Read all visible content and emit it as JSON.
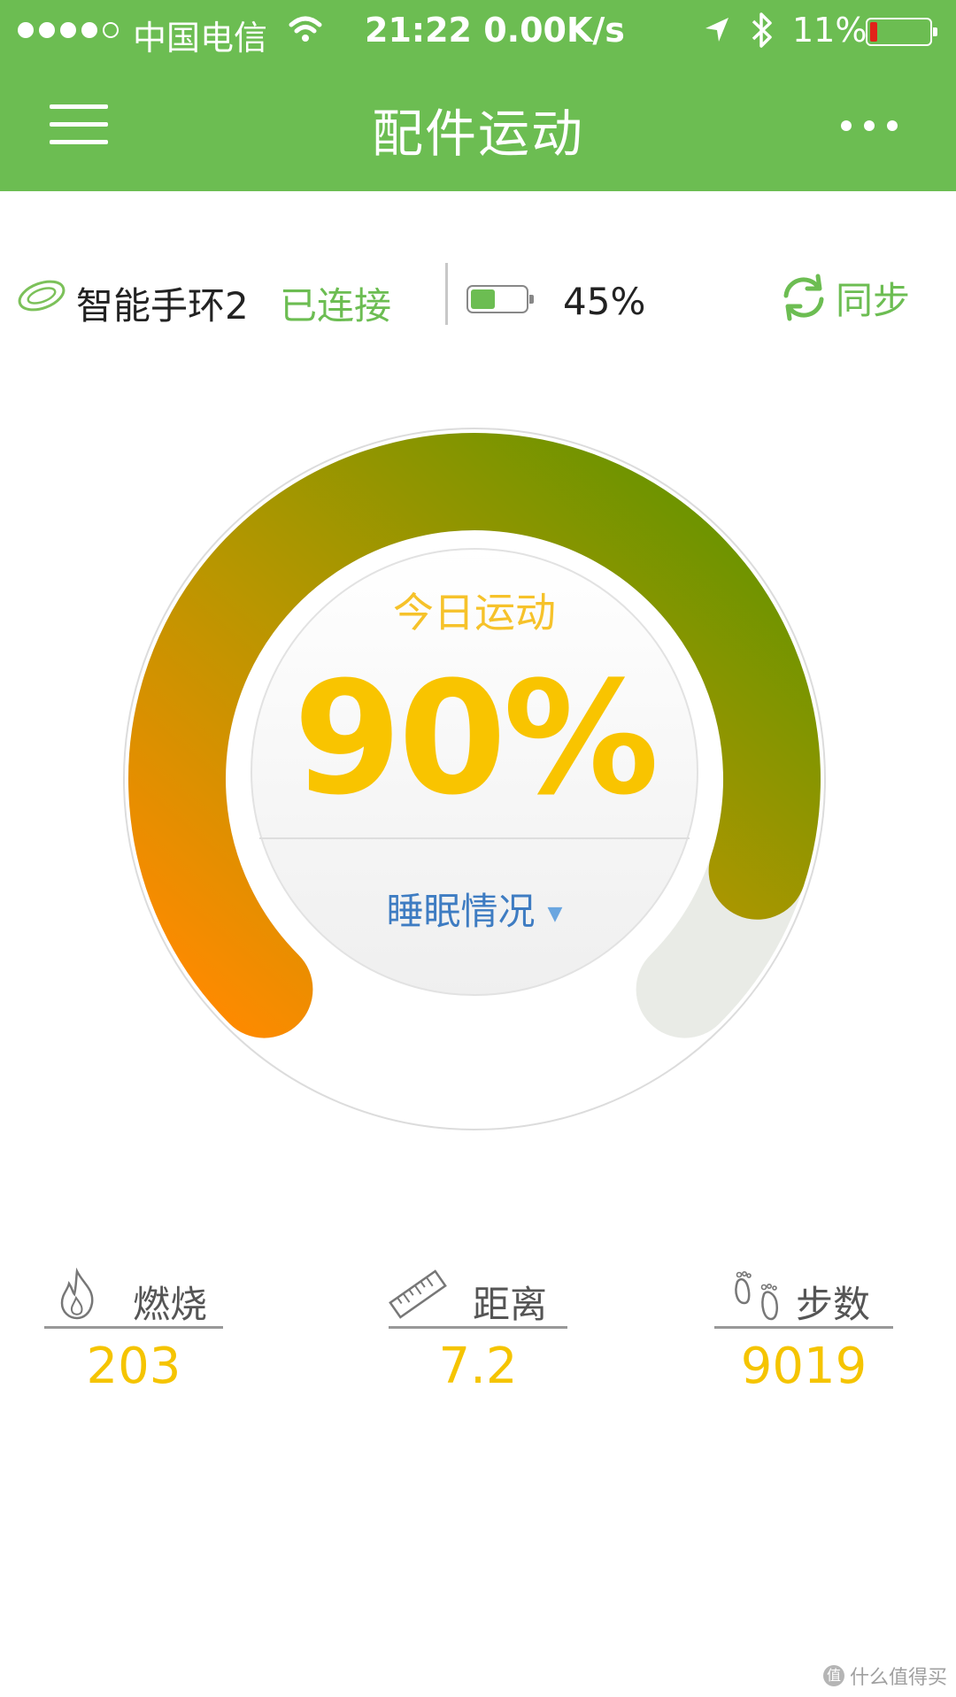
{
  "status_bar": {
    "carrier": "中国电信",
    "time_speed": "21:22 0.00K/s",
    "battery_pct": "11%",
    "battery_level": 0.11,
    "icons": [
      "signal-dots-icon",
      "wifi-icon",
      "location-arrow-icon",
      "bluetooth-icon",
      "battery-icon"
    ]
  },
  "nav": {
    "title": "配件运动",
    "left_icon": "hamburger-menu-icon",
    "right_icon": "more-dots-icon"
  },
  "device": {
    "name": "智能手环2",
    "status": "已连接",
    "battery_pct": "45%",
    "battery_level": 0.45,
    "sync_label": "同步",
    "icons": [
      "wristband-icon",
      "battery-icon",
      "sync-icon"
    ]
  },
  "activity": {
    "title": "今日运动",
    "percent": "90%",
    "progress": 0.9,
    "sleep_label": "睡眠情况"
  },
  "stats": [
    {
      "label": "燃烧",
      "value": "203",
      "icon": "flame-icon"
    },
    {
      "label": "距离",
      "value": "7.2",
      "icon": "ruler-icon"
    },
    {
      "label": "步数",
      "value": "9019",
      "icon": "footprints-icon"
    }
  ],
  "watermark": {
    "text": "什么值得买",
    "badge": "值"
  },
  "colors": {
    "brand_green": "#6cbd52",
    "gauge_start": "#ff8a00",
    "gauge_end": "#5f9400",
    "value_yellow": "#f5c400",
    "link_blue": "#3e7cc2"
  }
}
